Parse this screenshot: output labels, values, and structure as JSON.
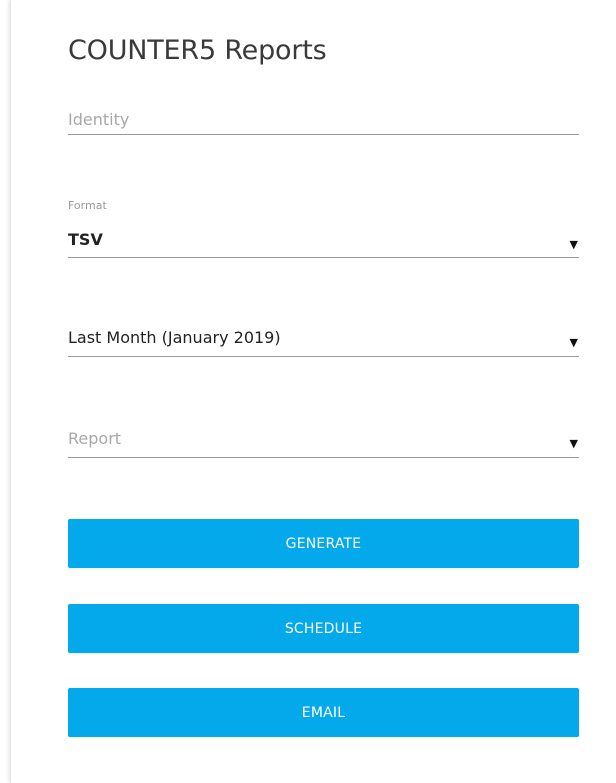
{
  "panel": {
    "title": "COUNTER5 Reports"
  },
  "form": {
    "identity": {
      "placeholder": "Identity",
      "value": ""
    },
    "format": {
      "label": "Format",
      "value": "TSV"
    },
    "period": {
      "value": "Last Month (January 2019)"
    },
    "report": {
      "placeholder": "Report"
    },
    "dropdown_icon": "triangle-down-icon"
  },
  "actions": {
    "generate_label": "GENERATE",
    "schedule_label": "SCHEDULE",
    "email_label": "EMAIL"
  },
  "colors": {
    "button": "#03a9eb",
    "button_text": "#ffffff",
    "underline": "#9a9a9a"
  }
}
